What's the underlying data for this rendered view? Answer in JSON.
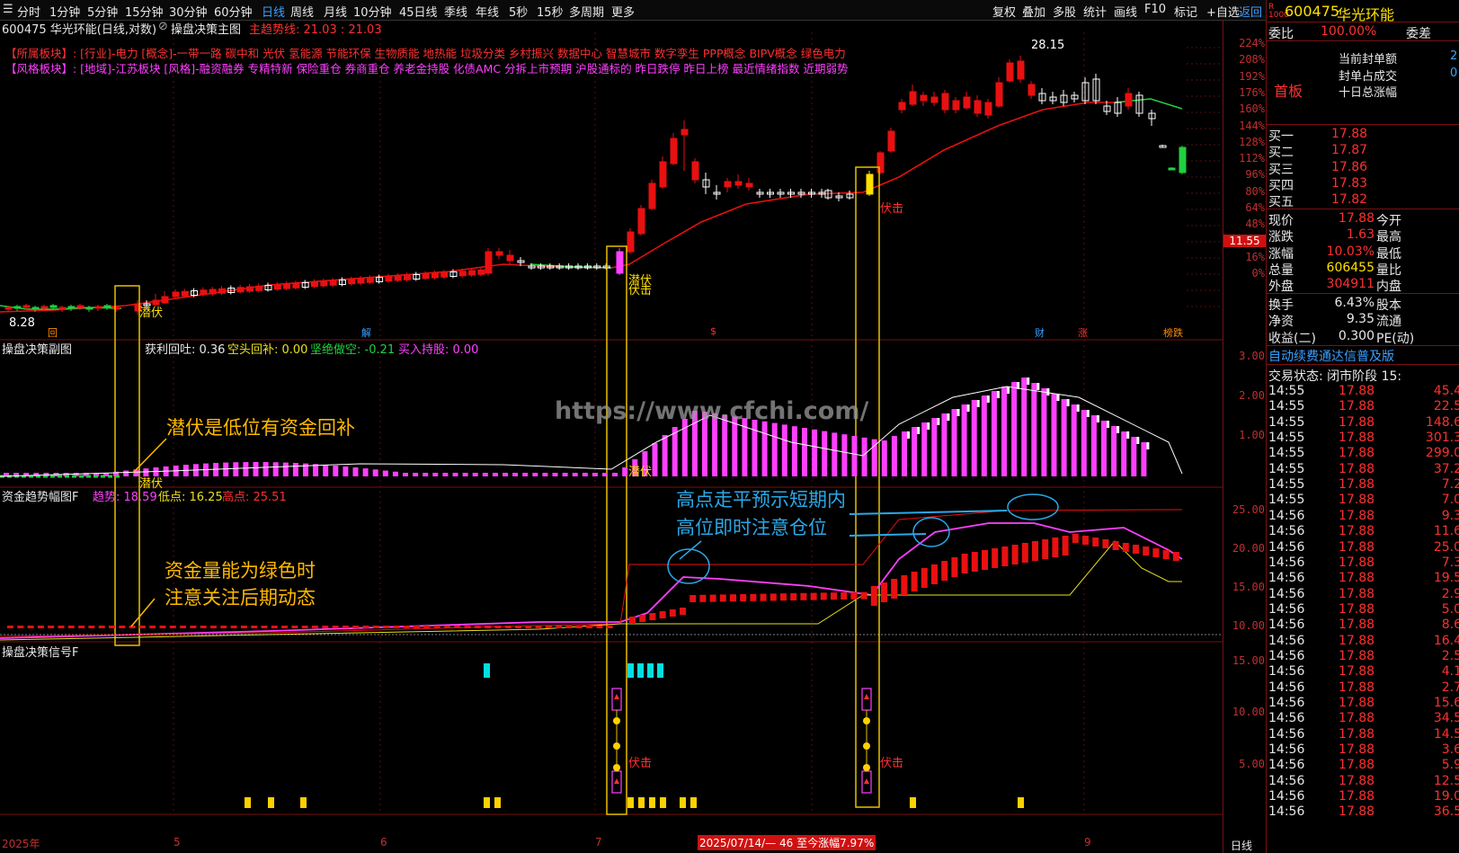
{
  "toolbar": {
    "timeframes": [
      "分时",
      "1分钟",
      "5分钟",
      "15分钟",
      "30分钟",
      "60分钟",
      "日线",
      "周线",
      "月线",
      "10分钟",
      "45日线",
      "季线",
      "年线",
      "5秒",
      "15秒",
      "多周期",
      "更多"
    ],
    "active_timeframe": "日线",
    "right_buttons": [
      "复权",
      "叠加",
      "多股",
      "统计",
      "画线",
      "F10",
      "标记",
      "+自选",
      "返回"
    ]
  },
  "main": {
    "title": "600475 华光环能(日线,对数)",
    "indicator_name": "操盘决策主图",
    "trend_line_label": "主趋势线: 21.03 : 21.03",
    "sector_line": "【所属板块】: [行业]-电力 [概念]-一带一路 碳中和 光伏 氢能源 节能环保 生物质能 地热能 垃圾分类 乡村振兴 数据中心 智慧城市 数字孪生 PPP概念 BIPV概念 绿色电力",
    "style_line": "【风格板块】: [地域]-江苏板块 [风格]-融资融券 专精特新 保险重仓 券商重仓 养老金持股 化债AMC 分拆上市预期 沪股通标的 昨日跌停 昨日上榜 最近情绪指数 近期弱势",
    "high_label": "28.15",
    "low_label": "8.28",
    "current_price_tag": "11.55",
    "axis_labels": [
      "224%",
      "208%",
      "192%",
      "176%",
      "160%",
      "144%",
      "128%",
      "112%",
      "96%",
      "80%",
      "64%",
      "48%",
      "32%",
      "16%",
      "0%"
    ],
    "signal_labels": {
      "qianfu1": "潜伏",
      "qianfu2": "潜伏",
      "fuji1": "伏击",
      "fuji_main": "伏击"
    },
    "event_markers": [
      "回",
      "解",
      "$",
      "财",
      "涨",
      "榜跌"
    ]
  },
  "sub1": {
    "name": "操盘决策副图",
    "values_text": [
      "获利回吐: 0.36",
      "空头回补: 0.00",
      "坚绝做空: -0.21",
      "买入持股: 0.00"
    ],
    "value_colors": [
      "#e8e8e8",
      "#e8e020",
      "#20d040",
      "#ff40ff"
    ],
    "axis_labels": [
      "3.00",
      "2.00",
      "1.00"
    ],
    "watermark": "https://www.cfchi.com/",
    "qianfu_a": "潜伏",
    "qianfu_b": "潜伏"
  },
  "sub2": {
    "name": "资金趋势幅图F",
    "trend": "趋势: 18.59",
    "low": "低点: 16.25",
    "high": "高点: 25.51",
    "axis_labels": [
      "25.00",
      "20.00",
      "15.00",
      "10.00"
    ]
  },
  "sub3": {
    "name": "操盘决策信号F",
    "axis_labels": [
      "15.00",
      "10.00",
      "5.00"
    ],
    "fuji_a": "伏击",
    "fuji_b": "伏击"
  },
  "annotations": {
    "a1": "潜伏是低位有资金回补",
    "a2_line1": "资金量能为绿色时",
    "a2_line2": "注意关注后期动态",
    "a3_line1": "高点走平预示短期内",
    "a3_line2": "高位即时注意仓位"
  },
  "xaxis": {
    "labels": [
      "2025年",
      "5",
      "6",
      "7",
      "9"
    ],
    "cursor_info": "2025/07/14/— 46 至今涨幅7.97%",
    "period": "日线"
  },
  "panel": {
    "code": "600475",
    "name": "华光环能",
    "weibi_label": "委比",
    "weibi_value": "100.00%",
    "weicha_label": "委差",
    "board_label": "首板",
    "seal_labels": [
      "当前封单额",
      "封单占成交",
      "十日总涨幅"
    ],
    "seal_values": [
      "2",
      "0",
      ""
    ],
    "bids": [
      {
        "label": "买一",
        "price": "17.88"
      },
      {
        "label": "买二",
        "price": "17.87"
      },
      {
        "label": "买三",
        "price": "17.86"
      },
      {
        "label": "买四",
        "price": "17.83"
      },
      {
        "label": "买五",
        "price": "17.82"
      }
    ],
    "quotes": [
      {
        "l": "现价",
        "v": "17.88",
        "r": "今开"
      },
      {
        "l": "涨跌",
        "v": "1.63",
        "r": "最高"
      },
      {
        "l": "涨幅",
        "v": "10.03%",
        "r": "最低"
      },
      {
        "l": "总量",
        "v": "606455",
        "r": "量比"
      },
      {
        "l": "外盘",
        "v": "304911",
        "r": "内盘"
      }
    ],
    "quotes2": [
      {
        "l": "换手",
        "v": "6.43%",
        "r": "股本"
      },
      {
        "l": "净资",
        "v": "9.35",
        "r": "流通"
      },
      {
        "l": "收益(二)",
        "v": "0.300",
        "r": "PE(动)"
      }
    ],
    "promo": "自动续费通达信普及版",
    "trade_status": "交易状态: 闭市阶段 15:",
    "ticks": [
      {
        "t": "14:55",
        "p": "17.88",
        "v": "45.4"
      },
      {
        "t": "14:55",
        "p": "17.88",
        "v": "22.5"
      },
      {
        "t": "14:55",
        "p": "17.88",
        "v": "148.6"
      },
      {
        "t": "14:55",
        "p": "17.88",
        "v": "301.3"
      },
      {
        "t": "14:55",
        "p": "17.88",
        "v": "299.0"
      },
      {
        "t": "14:55",
        "p": "17.88",
        "v": "37.2"
      },
      {
        "t": "14:55",
        "p": "17.88",
        "v": "7.2"
      },
      {
        "t": "14:55",
        "p": "17.88",
        "v": "7.0"
      },
      {
        "t": "14:56",
        "p": "17.88",
        "v": "9.3"
      },
      {
        "t": "14:56",
        "p": "17.88",
        "v": "11.6"
      },
      {
        "t": "14:56",
        "p": "17.88",
        "v": "25.0"
      },
      {
        "t": "14:56",
        "p": "17.88",
        "v": "7.3"
      },
      {
        "t": "14:56",
        "p": "17.88",
        "v": "19.5"
      },
      {
        "t": "14:56",
        "p": "17.88",
        "v": "2.9"
      },
      {
        "t": "14:56",
        "p": "17.88",
        "v": "5.0"
      },
      {
        "t": "14:56",
        "p": "17.88",
        "v": "8.6"
      },
      {
        "t": "14:56",
        "p": "17.88",
        "v": "16.4"
      },
      {
        "t": "14:56",
        "p": "17.88",
        "v": "2.5"
      },
      {
        "t": "14:56",
        "p": "17.88",
        "v": "4.1"
      },
      {
        "t": "14:56",
        "p": "17.88",
        "v": "2.7"
      },
      {
        "t": "14:56",
        "p": "17.88",
        "v": "15.6"
      },
      {
        "t": "14:56",
        "p": "17.88",
        "v": "34.5"
      },
      {
        "t": "14:56",
        "p": "17.88",
        "v": "14.5"
      },
      {
        "t": "14:56",
        "p": "17.88",
        "v": "3.6"
      },
      {
        "t": "14:56",
        "p": "17.88",
        "v": "5.9"
      },
      {
        "t": "14:56",
        "p": "17.88",
        "v": "12.5"
      },
      {
        "t": "14:56",
        "p": "17.88",
        "v": "19.0"
      },
      {
        "t": "14:56",
        "p": "17.88",
        "v": "36.5"
      }
    ]
  }
}
